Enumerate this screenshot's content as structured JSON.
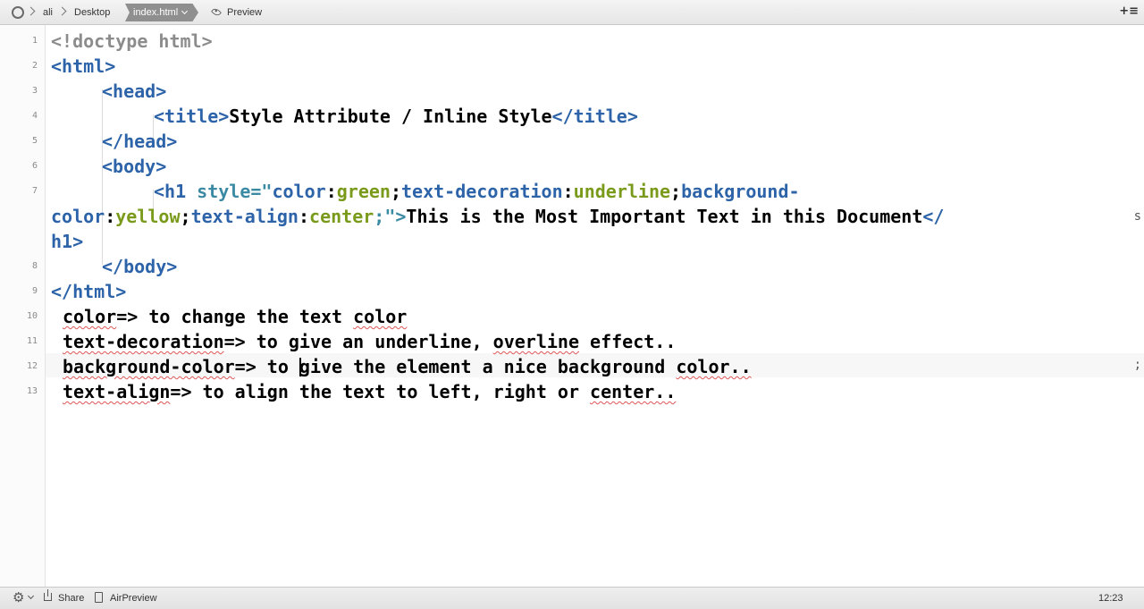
{
  "breadcrumb": {
    "items": [
      "ali",
      "Desktop"
    ],
    "active_file": "index.html",
    "preview_label": "Preview"
  },
  "editor": {
    "line_numbers": [
      "1",
      "2",
      "3",
      "4",
      "5",
      "6",
      "7",
      "8",
      "9",
      "10",
      "11",
      "12",
      "13"
    ],
    "lines": {
      "l1": "<!doctype html>",
      "l2": "<html>",
      "l3": "<head>",
      "l4_open": "<title>",
      "l4_text": "Style Attribute / Inline Style",
      "l4_close": "</title>",
      "l5": "</head>",
      "l6": "<body>",
      "l7_tag": "<h1 ",
      "l7_attr": "style=\"",
      "l7_p1": "color",
      "l7_v1": "green",
      "l7_p2": "text-decoration",
      "l7_v2": "underline",
      "l7_p3a": "background-",
      "l7_p3b": "color",
      "l7_v3": "yellow",
      "l7_p4": "text-align",
      "l7_v4": "center",
      "l7_end": ";\">",
      "l7_text": "This is the Most Important Text in this Document",
      "l7_close_a": "</",
      "l7_close_b": "h1>",
      "l8": "</body>",
      "l9": "</html>",
      "l10_a": "color",
      "l10_b": "=> to change the text ",
      "l10_c": "color",
      "l11_a": "text-decoration",
      "l11_b": "=> to give an underline, ",
      "l11_c": "overline",
      "l11_d": " effect..",
      "l12_a": "background-color",
      "l12_b": "=> to ",
      "l12_c": "give the element a nice background ",
      "l12_d": "color..",
      "l13_a": "text-align",
      "l13_b": "=> to align the text to left, right or ",
      "l13_c": "center.."
    }
  },
  "statusbar": {
    "share_label": "Share",
    "airpreview_label": "AirPreview",
    "cursor_position": "12:23"
  },
  "icons": {
    "nav": "circle-icon",
    "preview": "eye-icon",
    "settings": "gear-icon",
    "share": "share-icon",
    "airpreview": "device-icon",
    "new": "plus-menu-icon"
  }
}
